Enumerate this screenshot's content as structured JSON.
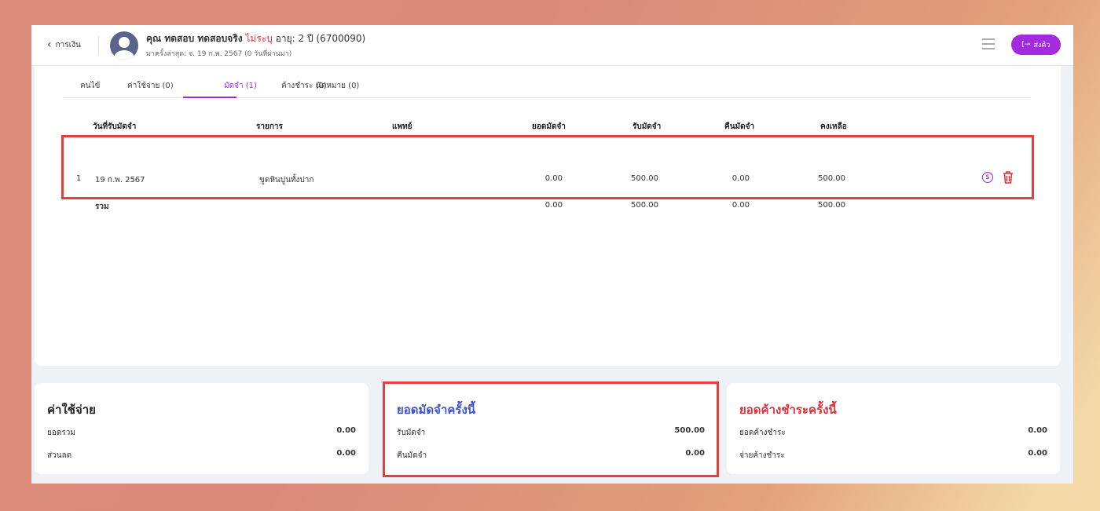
{
  "header": {
    "back_label": "การเงิน",
    "patient_name": "คุณ ทดสอบ ทดสอบจริง",
    "gender": "ไม่ระบุ",
    "age_id": "อายุ: 2 ปี (6700090)",
    "last_visit": "มาครั้งล่าสุด: จ. 19 ก.พ. 2567 (0 วันที่ผ่านมา)",
    "queue_button": "ส่งคิว"
  },
  "tabs": [
    {
      "label": "คนไข้"
    },
    {
      "label": "ค่าใช้จ่าย (0)"
    },
    {
      "label": "มัดจำ (1)"
    },
    {
      "label": "ค้างชำระ (0)"
    },
    {
      "label": "นัดหมาย (0)"
    }
  ],
  "table": {
    "headers": [
      "วันที่รับมัดจำ",
      "รายการ",
      "แพทย์",
      "ยอดมัดจำ",
      "รับมัดจำ",
      "คืนมัดจำ",
      "คงเหลือ"
    ],
    "rows": [
      {
        "no": "1",
        "date": "19 ก.พ. 2567",
        "item": "ขูดหินปูนทั้งปาก",
        "doctor": "",
        "deposit": "0.00",
        "received": "500.00",
        "refund": "0.00",
        "balance": "500.00"
      }
    ],
    "total": {
      "label": "รวม",
      "deposit": "0.00",
      "received": "500.00",
      "refund": "0.00",
      "balance": "500.00"
    }
  },
  "cards": {
    "expense": {
      "title": "ค่าใช้จ่าย",
      "rows": [
        {
          "label": "ยอดรวม",
          "value": "0.00"
        },
        {
          "label": "ส่วนลด",
          "value": "0.00"
        }
      ]
    },
    "deposit": {
      "title": "ยอดมัดจำครั้งนี้",
      "rows": [
        {
          "label": "รับมัดจำ",
          "value": "500.00"
        },
        {
          "label": "คืนมัดจำ",
          "value": "0.00"
        }
      ]
    },
    "outstanding": {
      "title": "ยอดค้างชำระครั้งนี้",
      "rows": [
        {
          "label": "ยอดค้างชำระ",
          "value": "0.00"
        },
        {
          "label": "จ่ายค้างชำระ",
          "value": "0.00"
        }
      ]
    }
  }
}
